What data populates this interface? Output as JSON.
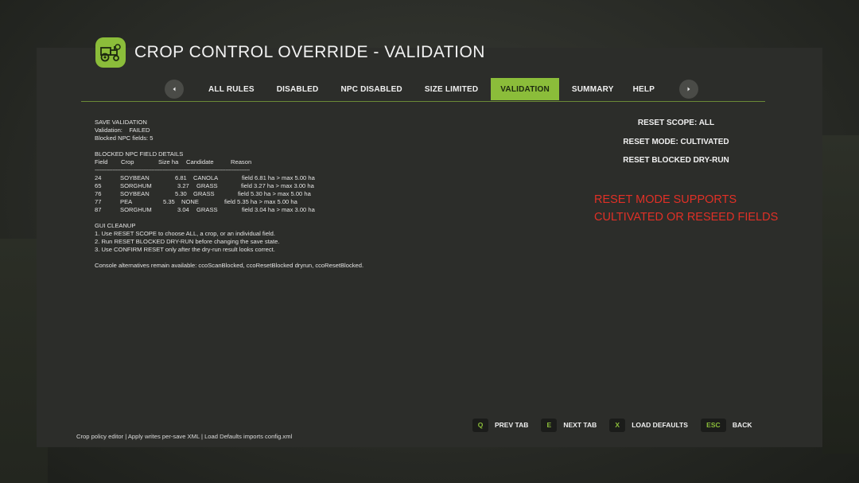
{
  "header": {
    "title": "CROP CONTROL OVERRIDE - VALIDATION",
    "logo_icon": "tractor-gear-icon"
  },
  "tabs": [
    {
      "label": "ALL RULES",
      "active": false
    },
    {
      "label": "DISABLED",
      "active": false
    },
    {
      "label": "NPC DISABLED",
      "active": false
    },
    {
      "label": "SIZE LIMITED",
      "active": false
    },
    {
      "label": "VALIDATION",
      "active": true
    },
    {
      "label": "SUMMARY",
      "active": false
    },
    {
      "label": "HELP",
      "active": false
    }
  ],
  "validation": {
    "heading": "SAVE VALIDATION",
    "status_line": "Validation:    FAILED",
    "blocked_line": "Blocked NPC fields: 5"
  },
  "details": {
    "heading": "BLOCKED NPC FIELD DETAILS",
    "columns": {
      "field": "Field",
      "crop": "Crop",
      "size": "Size ha",
      "candidate": "Candidate",
      "reason": "Reason"
    },
    "separator": "------------------------------------------------------------------------------------------------",
    "rows": [
      {
        "field": "24",
        "crop": "SOYBEAN",
        "size": "6.81",
        "candidate": "CANOLA",
        "reason": "field 6.81 ha > max 5.00 ha"
      },
      {
        "field": "65",
        "crop": "SORGHUM",
        "size": "3.27",
        "candidate": "GRASS",
        "reason": "field 3.27 ha > max 3.00 ha"
      },
      {
        "field": "76",
        "crop": "SOYBEAN",
        "size": "5.30",
        "candidate": "GRASS",
        "reason": "field 5.30 ha > max 5.00 ha"
      },
      {
        "field": "77",
        "crop": "PEA",
        "size": "5.35",
        "candidate": "NONE",
        "reason": "field 5.35 ha > max 5.00 ha"
      },
      {
        "field": "87",
        "crop": "SORGHUM",
        "size": "3.04",
        "candidate": "GRASS",
        "reason": "field 3.04 ha > max 3.00 ha"
      }
    ]
  },
  "cleanup": {
    "heading": "GUI CLEANUP",
    "steps": [
      "1. Use RESET SCOPE to choose ALL, a crop, or an individual field.",
      "2. Run RESET BLOCKED DRY-RUN before changing the save state.",
      "3. Use CONFIRM RESET only after the dry-run result looks correct."
    ],
    "console_note": "Console alternatives remain available: ccoScanBlocked, ccoResetBlocked dryrun, ccoResetBlocked."
  },
  "actions": {
    "reset_scope": "RESET SCOPE: ALL",
    "reset_mode": "RESET MODE: CULTIVATED",
    "reset_dry_run": "RESET BLOCKED DRY-RUN"
  },
  "warning": {
    "line1": "RESET MODE SUPPORTS",
    "line2": "CULTIVATED OR RESEED FIELDS",
    "color": "#e03026"
  },
  "footer": {
    "note": "Crop policy editor | Apply writes per-save XML | Load Defaults imports config.xml",
    "keys": [
      {
        "key": "Q",
        "label": "PREV TAB"
      },
      {
        "key": "E",
        "label": "NEXT TAB"
      },
      {
        "key": "X",
        "label": "LOAD DEFAULTS"
      },
      {
        "key": "ESC",
        "label": "BACK"
      }
    ]
  },
  "colors": {
    "accent": "#8bbd3a",
    "panel": "#2c2d2a",
    "warning": "#e03026"
  }
}
